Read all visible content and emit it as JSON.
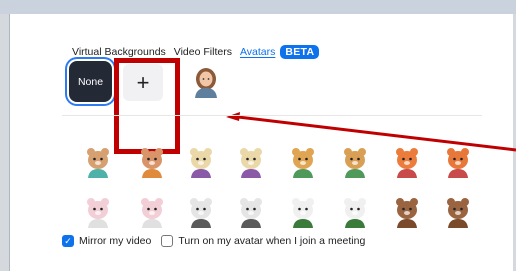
{
  "tabs": [
    {
      "label": "Virtual Backgrounds",
      "active": false
    },
    {
      "label": "Video Filters",
      "active": false
    },
    {
      "label": "Avatars",
      "active": true
    }
  ],
  "beta_badge": "BETA",
  "tiles": {
    "none_label": "None",
    "add_symbol": "+"
  },
  "avatars": [
    {
      "name": "person-avatar"
    },
    {
      "name": "cat-avatar",
      "color": "#d6a070"
    },
    {
      "name": "cat-avatar",
      "color": "#d9946a"
    },
    {
      "name": "cow-avatar",
      "color": "#ead8a8"
    },
    {
      "name": "cow-avatar",
      "color": "#ead8a8"
    },
    {
      "name": "dog-avatar",
      "color": "#e0a552"
    },
    {
      "name": "dog-avatar",
      "color": "#d9a055"
    },
    {
      "name": "fox-avatar",
      "color": "#ec7c3c"
    },
    {
      "name": "fox-avatar",
      "color": "#e8783a"
    },
    {
      "name": "rabbit-avatar",
      "color": "#f2ced6"
    },
    {
      "name": "rabbit-avatar",
      "color": "#f2ced6"
    },
    {
      "name": "raccoon-avatar",
      "color": "#e5e5e5"
    },
    {
      "name": "raccoon-avatar",
      "color": "#e5e5e5"
    },
    {
      "name": "panda-avatar",
      "color": "#f0f0f0"
    },
    {
      "name": "panda-avatar",
      "color": "#f0f0f0"
    },
    {
      "name": "otter-avatar",
      "color": "#9a6440"
    },
    {
      "name": "otter-avatar",
      "color": "#9a6440"
    }
  ],
  "options": [
    {
      "label": "Mirror my video",
      "checked": true
    },
    {
      "label": "Turn on my avatar when I join a meeting",
      "checked": false
    }
  ],
  "colors": {
    "accent": "#0e72ed",
    "annotation": "#c00000",
    "selected_tile": "#242936"
  }
}
